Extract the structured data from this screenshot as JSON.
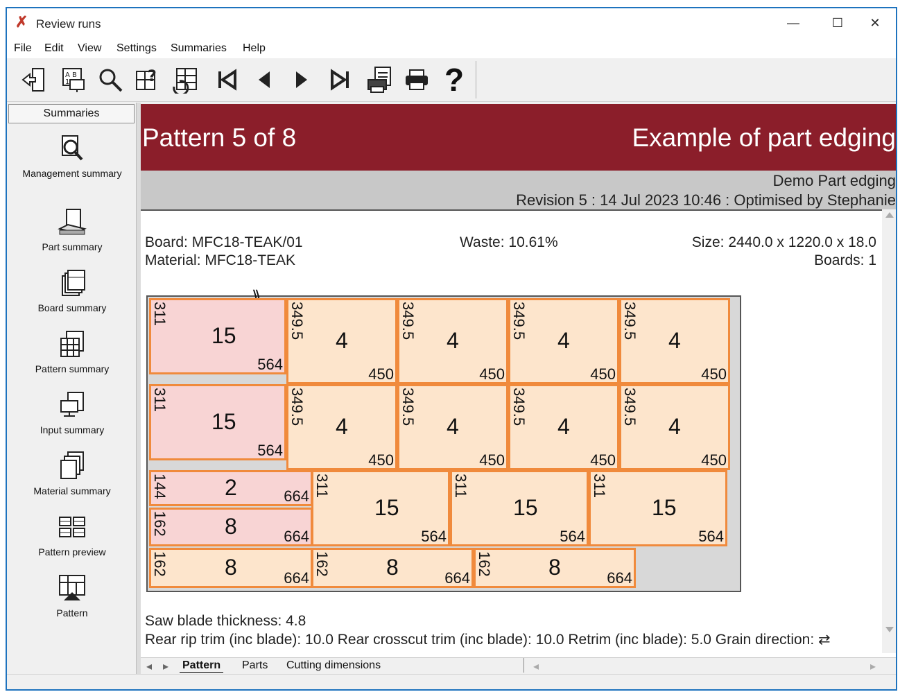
{
  "window": {
    "title": "Review runs",
    "minimize": "—",
    "maximize": "☐",
    "close": "✕"
  },
  "menu": [
    {
      "label": "File"
    },
    {
      "label": "Edit"
    },
    {
      "label": "View"
    },
    {
      "label": "Settings"
    },
    {
      "label": "Summaries"
    },
    {
      "label": "Help"
    }
  ],
  "toolbar": [
    {
      "icon": "exit-icon"
    },
    {
      "icon": "parameters-icon"
    },
    {
      "icon": "search-icon"
    },
    {
      "icon": "undo-pattern-icon"
    },
    {
      "icon": "refresh-pattern-icon"
    },
    {
      "icon": "first-icon"
    },
    {
      "icon": "previous-icon"
    },
    {
      "icon": "next-icon"
    },
    {
      "icon": "last-icon"
    },
    {
      "icon": "print-preview-icon"
    },
    {
      "icon": "print-icon"
    },
    {
      "icon": "help-icon",
      "label": "?"
    }
  ],
  "sidebar": {
    "header": "Summaries",
    "items": [
      {
        "label": "Management summary",
        "icon": "management-summary-icon"
      },
      {
        "label": "Part summary",
        "icon": "part-summary-icon"
      },
      {
        "label": "Board summary",
        "icon": "board-summary-icon"
      },
      {
        "label": "Pattern summary",
        "icon": "pattern-summary-icon"
      },
      {
        "label": "Input summary",
        "icon": "input-summary-icon"
      },
      {
        "label": "Material summary",
        "icon": "material-summary-icon"
      },
      {
        "label": "Pattern preview",
        "icon": "pattern-preview-icon"
      },
      {
        "label": "Pattern",
        "icon": "pattern-icon"
      }
    ]
  },
  "report": {
    "pattern_title": "Pattern 5 of 8",
    "job_title": "Example of part edging",
    "job_name": "Demo Part edging",
    "revision_line": "Revision 5 : 14 Jul 2023 10:46 : Optimised by Stephanie",
    "board": "Board: MFC18-TEAK/01",
    "material": "Material: MFC18-TEAK",
    "waste": "Waste: 10.61%",
    "size": "Size: 2440.0 x 1220.0 x  18.0",
    "boards": "Boards: 1",
    "saw_blade": "Saw blade thickness: 4.8",
    "trims": "Rear rip trim (inc blade): 10.0 Rear crosscut trim (inc blade): 10.0 Retrim (inc blade): 5.0 Grain direction: ⇄"
  },
  "pattern": {
    "grain_symbol": "⟫",
    "parts": [
      {
        "qty": "15",
        "length": "564",
        "width": "311",
        "color": "pink"
      },
      {
        "qty": "4",
        "length": "450",
        "width": "349.5",
        "color": "orange"
      },
      {
        "qty": "4",
        "length": "450",
        "width": "349.5",
        "color": "orange"
      },
      {
        "qty": "4",
        "length": "450",
        "width": "349.5",
        "color": "orange"
      },
      {
        "qty": "4",
        "length": "450",
        "width": "349.5",
        "color": "orange"
      },
      {
        "qty": "15",
        "length": "564",
        "width": "311",
        "color": "pink"
      },
      {
        "qty": "4",
        "length": "450",
        "width": "349.5",
        "color": "orange"
      },
      {
        "qty": "4",
        "length": "450",
        "width": "349.5",
        "color": "orange"
      },
      {
        "qty": "4",
        "length": "450",
        "width": "349.5",
        "color": "orange"
      },
      {
        "qty": "4",
        "length": "450",
        "width": "349.5",
        "color": "orange"
      },
      {
        "qty": "2",
        "length": "664",
        "width": "144",
        "color": "pink"
      },
      {
        "qty": "8",
        "length": "664",
        "width": "162",
        "color": "pink"
      },
      {
        "qty": "15",
        "length": "564",
        "width": "311",
        "color": "orange"
      },
      {
        "qty": "15",
        "length": "564",
        "width": "311",
        "color": "orange"
      },
      {
        "qty": "15",
        "length": "564",
        "width": "311",
        "color": "orange"
      },
      {
        "qty": "8",
        "length": "664",
        "width": "162",
        "color": "orange"
      },
      {
        "qty": "8",
        "length": "664",
        "width": "162",
        "color": "orange"
      },
      {
        "qty": "8",
        "length": "664",
        "width": "162",
        "color": "orange"
      }
    ]
  },
  "tabs": [
    {
      "label": "Pattern",
      "active": true
    },
    {
      "label": "Parts"
    },
    {
      "label": "Cutting dimensions"
    }
  ],
  "colors": {
    "banner": "#8b1e2a",
    "part_orange_fill": "#fde5cc",
    "part_pink_fill": "#f8d4d4",
    "part_border": "#f08a3c"
  }
}
